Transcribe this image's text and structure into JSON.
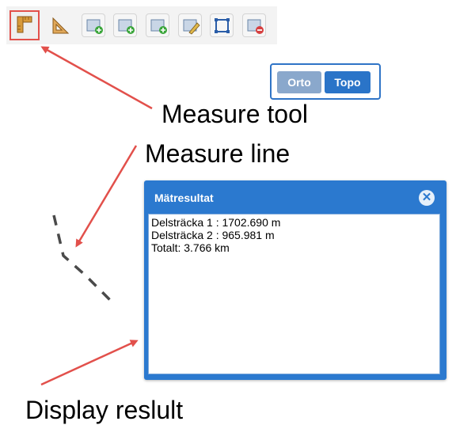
{
  "toolbar": {
    "tools": [
      {
        "icon": "ruler-icon",
        "label": "Measure tool",
        "selected": true
      },
      {
        "icon": "triangle-ruler-icon"
      },
      {
        "icon": "add-point-icon"
      },
      {
        "icon": "add-line-icon"
      },
      {
        "icon": "add-polygon-icon"
      },
      {
        "icon": "edit-icon"
      },
      {
        "icon": "select-box-icon"
      },
      {
        "icon": "delete-icon"
      }
    ]
  },
  "layers": {
    "orto": "Orto",
    "topo": "Topo",
    "active": "Topo"
  },
  "result_panel": {
    "title": "Mätresultat",
    "lines": [
      "Delsträcka 1 : 1702.690 m",
      "Delsträcka 2 : 965.981 m",
      "Totalt: 3.766 km"
    ]
  },
  "annotations": {
    "measure_tool": "Measure tool",
    "measure_line": "Measure line",
    "display_result": "Display reslult"
  },
  "colors": {
    "accent": "#2b79cf",
    "arrow": "#e2504b",
    "highlight": "#e2504b"
  }
}
